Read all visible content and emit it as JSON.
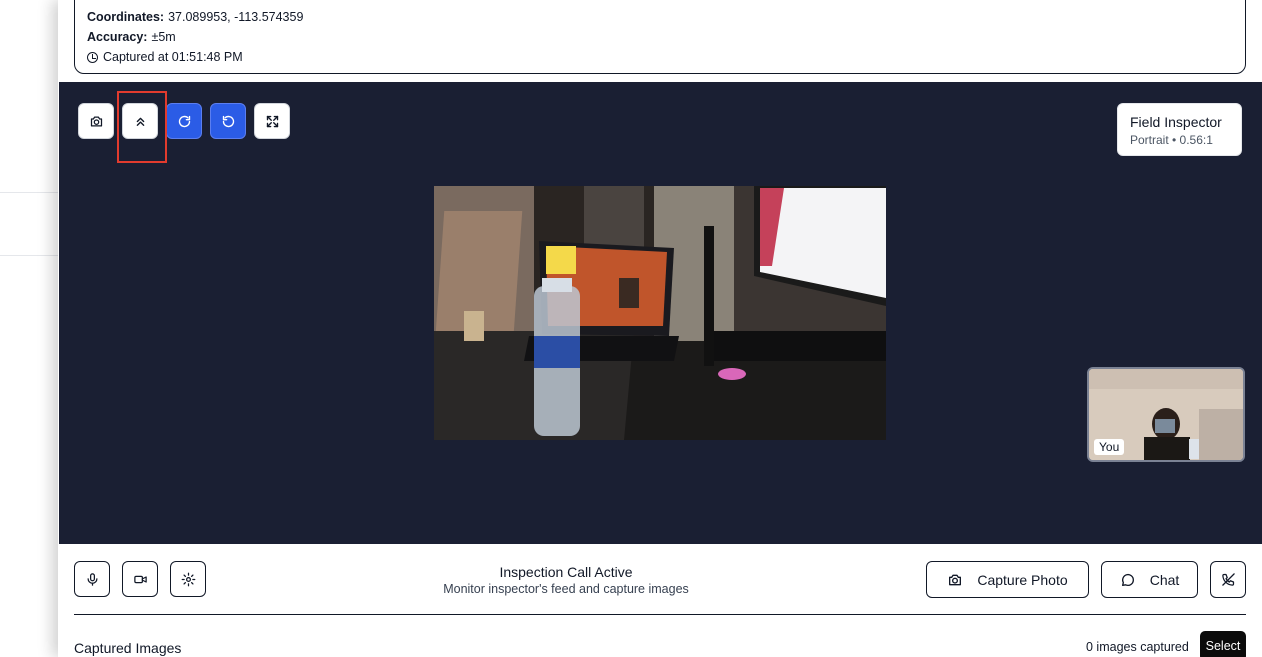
{
  "location": {
    "coordinates_label": "Coordinates:",
    "coordinates_value": "37.089953, -113.574359",
    "accuracy_label": "Accuracy:",
    "accuracy_value": "±5m",
    "captured_at": "Captured at 01:51:48 PM"
  },
  "toolbar": {
    "buttons": [
      {
        "icon": "camera-icon",
        "style": "white"
      },
      {
        "icon": "chevrons-up-icon",
        "style": "white",
        "highlighted": true
      },
      {
        "icon": "rotate-cw-icon",
        "style": "blue"
      },
      {
        "icon": "rotate-ccw-icon",
        "style": "blue"
      },
      {
        "icon": "fullscreen-icon",
        "style": "white"
      }
    ]
  },
  "inspector": {
    "name": "Field Inspector",
    "meta": "Portrait • 0.56:1"
  },
  "self_view": {
    "label": "You"
  },
  "status": {
    "title": "Inspection Call Active",
    "subtitle": "Monitor inspector's feed and capture images"
  },
  "actions": {
    "capture_label": "Capture Photo",
    "chat_label": "Chat"
  },
  "captured": {
    "title": "Captured Images",
    "count": "0 images captured",
    "select_label": "Select"
  },
  "colors": {
    "video_bg": "#1a1f33",
    "accent_blue": "#2b5ce6",
    "highlight_red": "#e23b2e"
  }
}
